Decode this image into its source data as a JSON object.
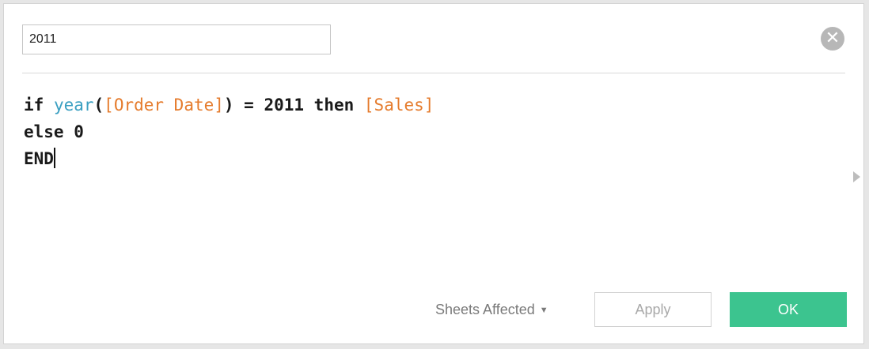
{
  "dialog": {
    "calc_name": "2011",
    "close_icon": "close-circle-icon"
  },
  "formula": {
    "l1_kw_if": "if ",
    "l1_fn_year": "year",
    "l1_paren_open": "(",
    "l1_field_order_date": "[Order Date]",
    "l1_rest": ") = 2011 then ",
    "l1_field_sales": "[Sales]",
    "l2": "else 0",
    "l3": "END"
  },
  "footer": {
    "sheets_affected_label": "Sheets Affected",
    "sheets_affected_caret": "▼",
    "apply_label": "Apply",
    "ok_label": "OK"
  },
  "colors": {
    "function": "#3a9fc1",
    "field": "#e57b2c",
    "ok_button": "#3cc48f"
  }
}
